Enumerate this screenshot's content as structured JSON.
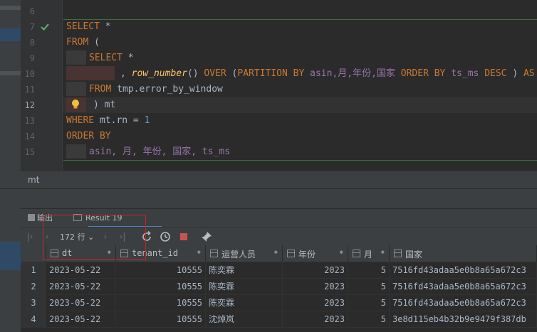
{
  "editor": {
    "line_numbers": [
      "6",
      "7",
      "8",
      "9",
      "10",
      "11",
      "12",
      "13",
      "14",
      "15"
    ],
    "current_line": "12",
    "code": {
      "l7": {
        "kw1": "SELECT",
        "rest": " *"
      },
      "l8": {
        "kw1": "FROM",
        "rest": " ("
      },
      "l9": {
        "kw1": "SELECT",
        "rest": " *"
      },
      "l10": {
        "p1": ", ",
        "fn": "row_number",
        "p2": "() ",
        "kw1": "OVER",
        "p3": " (",
        "kw2": "PARTITION BY",
        "cols": " asin,月,年份,国家 ",
        "kw3": "ORDER BY",
        "cols2": " ts_ms ",
        "kw4": "DESC",
        "p4": " ) ",
        "kw5": "AS"
      },
      "l11": {
        "kw1": "FROM",
        "rest": " tmp.error_by_window"
      },
      "l12": {
        "rest": ") mt"
      },
      "l13": {
        "kw1": "WHERE",
        "rest": " mt.rn = ",
        "num": "1"
      },
      "l14": {
        "kw1": "ORDER BY"
      },
      "l15": {
        "cols": "asin, 月, 年份, 国家, ts_ms"
      }
    }
  },
  "breadcrumb": "mt",
  "tabs": {
    "output": "输出",
    "result": "Result 19"
  },
  "toolbar": {
    "rows": "172 行",
    "chevron": "⌄"
  },
  "grid": {
    "columns": [
      "dt",
      "tenant_id",
      "运营人员",
      "年份",
      "月",
      "国家"
    ],
    "rows": [
      {
        "n": "1",
        "dt": "2023-05-22",
        "tenant_id": "10555",
        "op": "陈奕霖",
        "year": "2023",
        "month": "5",
        "country": "7516fd43adaa5e0b8a65a672c3"
      },
      {
        "n": "2",
        "dt": "2023-05-22",
        "tenant_id": "10555",
        "op": "陈奕霖",
        "year": "2023",
        "month": "5",
        "country": "7516fd43adaa5e0b8a65a672c3"
      },
      {
        "n": "3",
        "dt": "2023-05-22",
        "tenant_id": "10555",
        "op": "陈奕霖",
        "year": "2023",
        "month": "5",
        "country": "7516fd43adaa5e0b8a65a672c3"
      },
      {
        "n": "4",
        "dt": "2023-05-22",
        "tenant_id": "10555",
        "op": "沈焯岚",
        "year": "2023",
        "month": "5",
        "country": "3e8d115eb4b32b9e9479f387db"
      }
    ]
  },
  "colors": {
    "keyword": "#cc7832",
    "identifier": "#9876aa",
    "function": "#ffc66d",
    "number": "#6897bb",
    "highlight_box": "#c0272d"
  }
}
